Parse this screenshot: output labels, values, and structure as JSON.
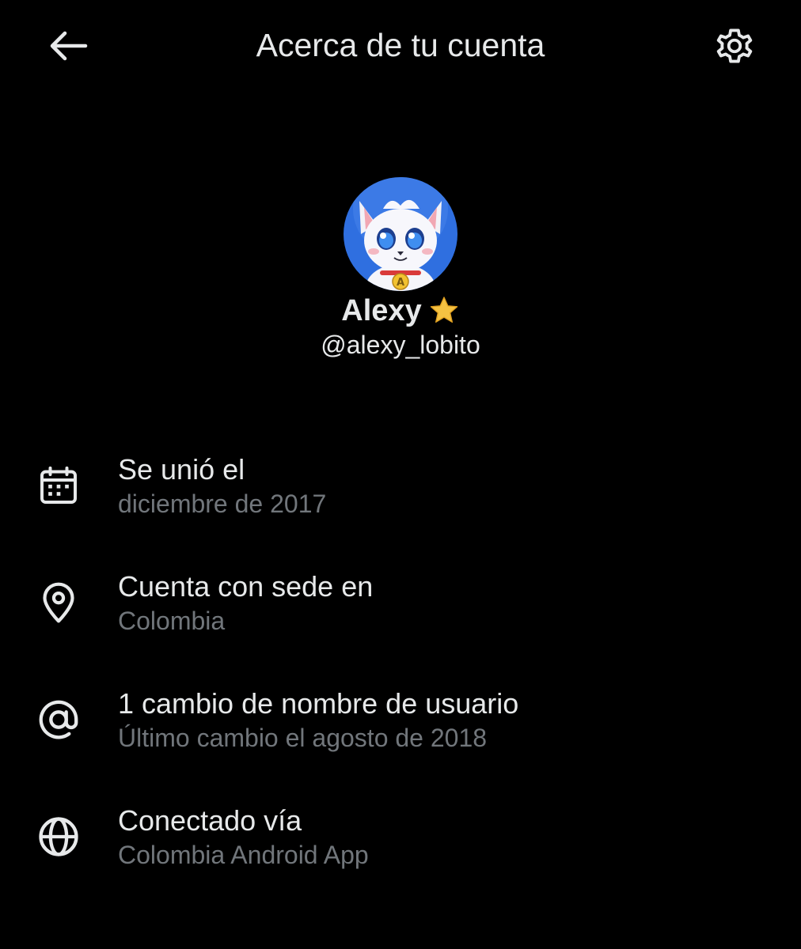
{
  "header": {
    "title": "Acerca de tu cuenta",
    "back_icon": "arrow-left-icon",
    "settings_icon": "gear-icon"
  },
  "profile": {
    "display_name": "Alexy",
    "badge_icon": "star-icon",
    "handle": "@alexy_lobito",
    "avatar_badge_letter": "A"
  },
  "info": [
    {
      "icon": "calendar-icon",
      "title": "Se unió el",
      "subtitle": "diciembre de 2017"
    },
    {
      "icon": "location-pin-icon",
      "title": "Cuenta con sede en",
      "subtitle": "Colombia"
    },
    {
      "icon": "at-sign-icon",
      "title": "1 cambio de nombre de usuario",
      "subtitle": "Último cambio el agosto de 2018"
    },
    {
      "icon": "globe-icon",
      "title": "Conectado vía",
      "subtitle": "Colombia Android App"
    }
  ],
  "colors": {
    "background": "#000000",
    "primary_text": "#e7e9ea",
    "secondary_text": "#71767b",
    "star": "#f5c242",
    "avatar_bg": "#2f6fe0"
  }
}
